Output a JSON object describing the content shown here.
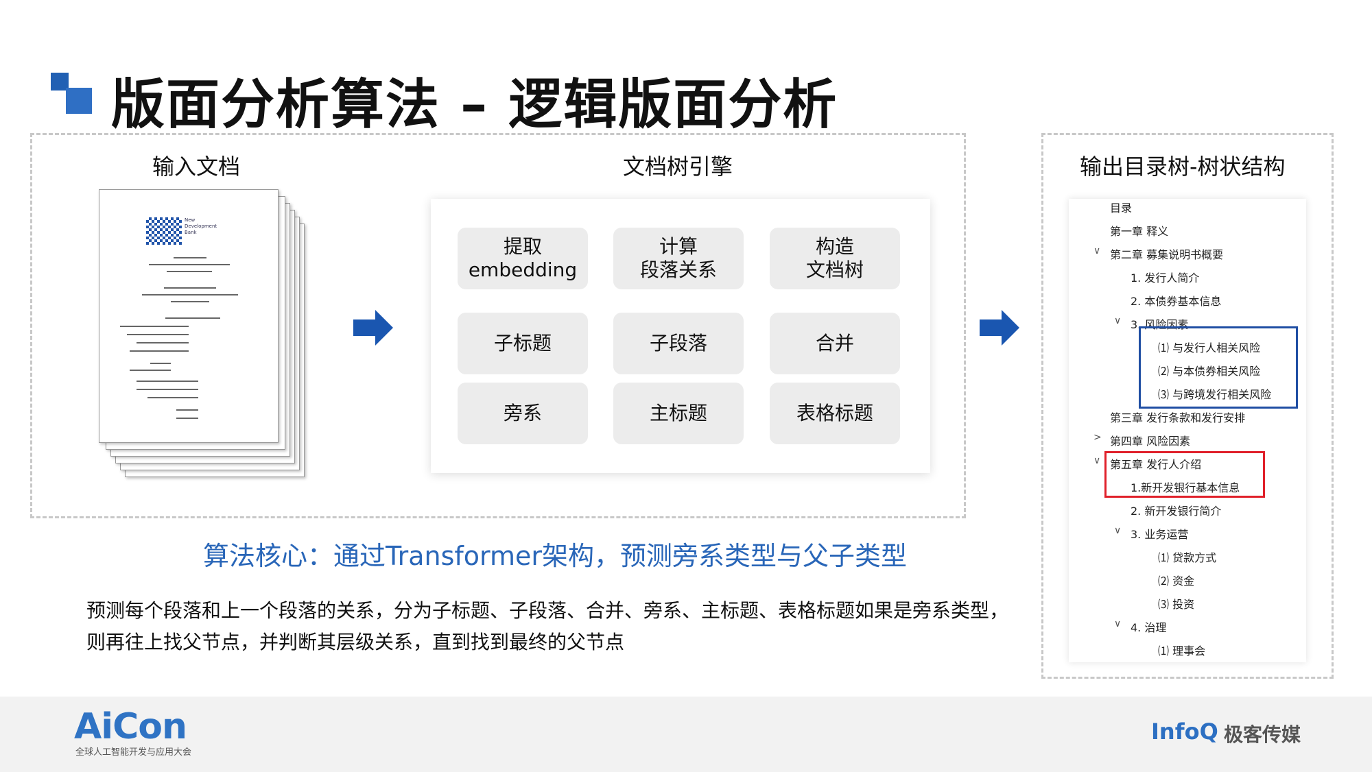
{
  "slide": {
    "title": "版面分析算法 – 逻辑版面分析"
  },
  "sections": {
    "input_label": "输入文档",
    "engine_label": "文档树引擎",
    "output_label": "输出目录树-树状结构"
  },
  "input_document": {
    "logo_text": [
      "New",
      "Development",
      "Bank"
    ]
  },
  "engine": {
    "cells": [
      [
        "提取",
        "embedding"
      ],
      [
        "计算",
        "段落关系"
      ],
      [
        "构造",
        "文档树"
      ],
      [
        "子标题"
      ],
      [
        "子段落"
      ],
      [
        "合并"
      ],
      [
        "旁系"
      ],
      [
        "主标题"
      ],
      [
        "表格标题"
      ]
    ]
  },
  "core": {
    "headline": "算法核心：通过Transformer架构，预测旁系类型与父子类型",
    "description": "预测每个段落和上一个段落的关系，分为子标题、子段落、合并、旁系、主标题、表格标题如果是旁系类型，则再往上找父节点，并判断其层级关系，直到找到最终的父节点"
  },
  "toc": {
    "items": [
      {
        "text": "目录",
        "chevron": ""
      },
      {
        "text": "第一章  释义",
        "chevron": ""
      },
      {
        "text": "第二章  募集说明书概要",
        "chevron": "∨"
      },
      {
        "text": "1.  发行人简介",
        "chevron": ""
      },
      {
        "text": "2.  本债券基本信息",
        "chevron": ""
      },
      {
        "text": "3.  风险因素",
        "chevron": "∨"
      },
      {
        "text": "⑴  与发行人相关风险",
        "chevron": ""
      },
      {
        "text": "⑵  与本债券相关风险",
        "chevron": ""
      },
      {
        "text": "⑶  与跨境发行相关风险",
        "chevron": ""
      },
      {
        "text": "第三章  发行条款和发行安排",
        "chevron": ""
      },
      {
        "text": "第四章  风险因素",
        "chevron": ">"
      },
      {
        "text": "第五章  发行人介绍",
        "chevron": "∨"
      },
      {
        "text": "1.新开发银行基本信息",
        "chevron": ""
      },
      {
        "text": "2.  新开发银行简介",
        "chevron": ""
      },
      {
        "text": "3.  业务运营",
        "chevron": "∨"
      },
      {
        "text": "⑴  贷款方式",
        "chevron": ""
      },
      {
        "text": "⑵  资金",
        "chevron": ""
      },
      {
        "text": "⑶  投资",
        "chevron": ""
      },
      {
        "text": "4.  治理",
        "chevron": "∨"
      },
      {
        "text": "⑴  理事会",
        "chevron": ""
      }
    ]
  },
  "footer": {
    "aicon_logo": "AiCon",
    "aicon_subtitle": "全球人工智能开发与应用大会",
    "infoq_logo": "InfoQ",
    "infoq_cn": "极客传媒"
  },
  "colors": {
    "accent_blue": "#2966b8",
    "highlight_blue": "#1f4ea3",
    "highlight_red": "#e0202a",
    "arrow_blue": "#1a56b0"
  }
}
